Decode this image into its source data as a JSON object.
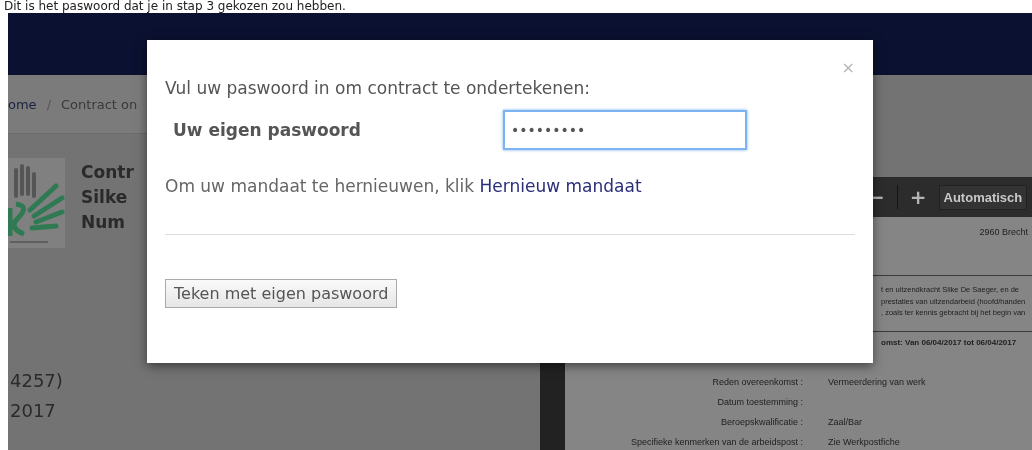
{
  "caption": "Dit is het paswoord dat je in stap 3 gekozen zou hebben.",
  "breadcrumb": {
    "items": [
      {
        "label": "ome"
      },
      {
        "label": "Contract on"
      }
    ],
    "separator": "/"
  },
  "contract_summary": {
    "title_lines": [
      "Contr",
      "Silke",
      "Num"
    ],
    "details": [
      "4257)",
      "2017"
    ]
  },
  "pdf_viewer": {
    "toolbar": {
      "zoom_out": "−",
      "zoom_in": "+",
      "zoom_select": "Automatisch"
    },
    "document": {
      "address": "2960 Brecht",
      "paragraph": [
        "t en uitzendkracht Silke De Saeger, en de",
        "prestaties van uitzendarbeid (hoofd/handen",
        ", zoals ter kennis gebracht bij het begin van"
      ],
      "period": "omst: Van 06/04/2017 tot 06/04/2017",
      "rows": [
        {
          "label": "Reden overeenkomst :",
          "value": "Vermeerdering van werk"
        },
        {
          "label": "Datum toestemming :"
        },
        {
          "label": "Beroepskwalificatie :",
          "value": "Zaal/Bar"
        },
        {
          "label": "Specifieke kenmerken van de arbeidspost :",
          "value": "Zie Werkpostfiche"
        }
      ]
    }
  },
  "modal": {
    "close": "×",
    "title": "Vul uw paswoord in om contract te ondertekenen:",
    "field_label": "Uw eigen paswoord",
    "field_value": "•••••••••",
    "focused": true,
    "renew_text": "Om uw mandaat te hernieuwen, klik",
    "renew_link": "Hernieuw mandaat",
    "submit": "Teken met eigen paswoord"
  }
}
